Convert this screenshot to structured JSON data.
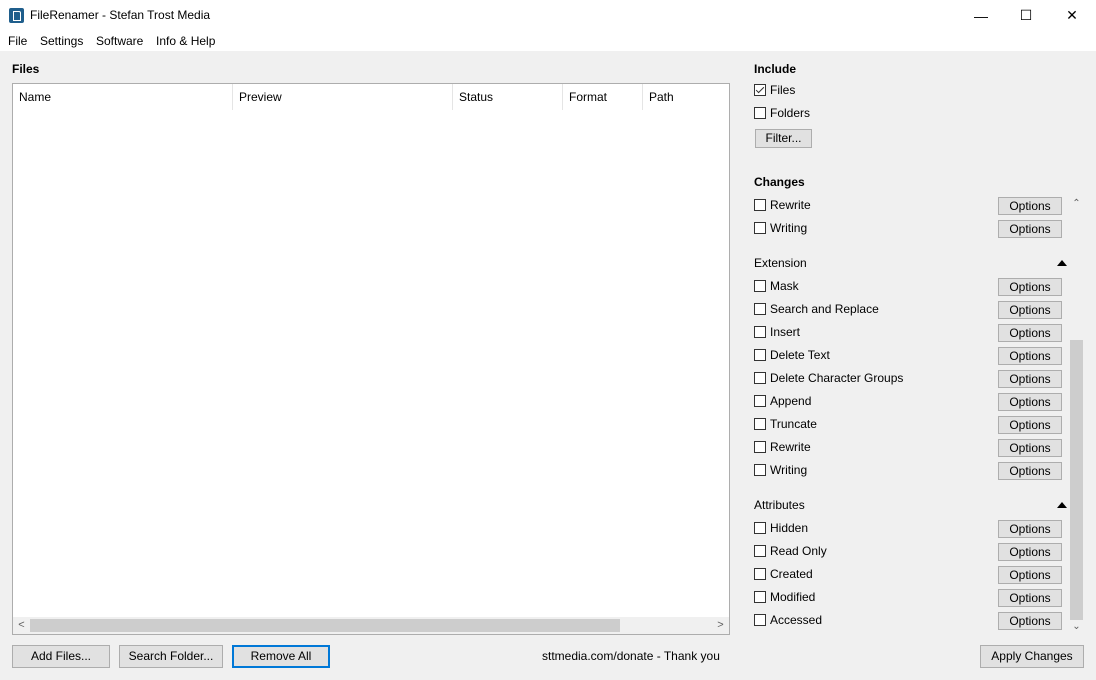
{
  "window": {
    "title": "FileRenamer - Stefan Trost Media",
    "controls": {
      "minimize": "—",
      "maximize": "☐",
      "close": "✕"
    }
  },
  "menu": [
    "File",
    "Settings",
    "Software",
    "Info & Help"
  ],
  "files": {
    "label": "Files",
    "columns": [
      "Name",
      "Preview",
      "Status",
      "Format",
      "Path"
    ],
    "rows": []
  },
  "buttons": {
    "add_files": "Add Files...",
    "search_folder": "Search Folder...",
    "remove_all": "Remove All",
    "apply_changes": "Apply Changes",
    "filter": "Filter..."
  },
  "donate_text": "sttmedia.com/donate - Thank you",
  "include": {
    "label": "Include",
    "items": [
      {
        "label": "Files",
        "checked": true
      },
      {
        "label": "Folders",
        "checked": false
      }
    ]
  },
  "changes": {
    "label": "Changes",
    "options_label": "Options",
    "name_items": [
      {
        "label": "Rewrite",
        "checked": false
      },
      {
        "label": "Writing",
        "checked": false
      }
    ],
    "extension": {
      "label": "Extension",
      "items": [
        {
          "label": "Mask",
          "checked": false
        },
        {
          "label": "Search and Replace",
          "checked": false
        },
        {
          "label": "Insert",
          "checked": false
        },
        {
          "label": "Delete Text",
          "checked": false
        },
        {
          "label": "Delete Character Groups",
          "checked": false
        },
        {
          "label": "Append",
          "checked": false
        },
        {
          "label": "Truncate",
          "checked": false
        },
        {
          "label": "Rewrite",
          "checked": false
        },
        {
          "label": "Writing",
          "checked": false
        }
      ]
    },
    "attributes": {
      "label": "Attributes",
      "items": [
        {
          "label": "Hidden",
          "checked": false
        },
        {
          "label": "Read Only",
          "checked": false
        },
        {
          "label": "Created",
          "checked": false
        },
        {
          "label": "Modified",
          "checked": false
        },
        {
          "label": "Accessed",
          "checked": false
        }
      ]
    }
  },
  "colors": {
    "focus": "#0078d7",
    "app_icon": "#1f5e8c"
  }
}
